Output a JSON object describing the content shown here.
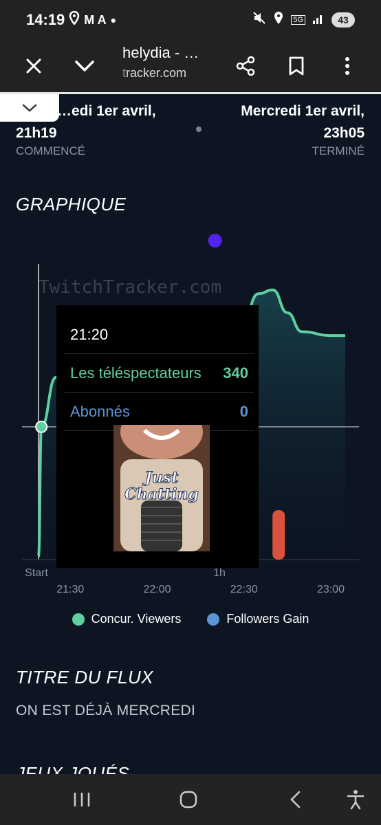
{
  "status": {
    "time": "14:19",
    "indicators": "M A",
    "battery": "43"
  },
  "browser": {
    "title": "helydia - …",
    "url_dim": "t",
    "url": "racker.com"
  },
  "stream": {
    "start_date": "…edi 1er avril,",
    "start_time": "21h19",
    "start_label": "COMMENCÉ",
    "end_date": "Mercredi 1er avril,",
    "end_time": "23h05",
    "end_label": "TERMINÉ"
  },
  "section_graph": "GRAPHIQUE",
  "section_title": "TITRE DU FLUX",
  "section_games": "JEUX JOUÉS",
  "stream_title": "ON EST DÉJÀ MERCREDI",
  "chart_data": {
    "type": "line",
    "watermark": "TwitchTracker.com",
    "x_ticks": [
      "21:30",
      "22:00",
      "22:30",
      "23:00"
    ],
    "x_time_labels": [
      "Start",
      "1h"
    ],
    "series": [
      {
        "name": "Concur. Viewers",
        "color": "#5fcf9f",
        "x": [
          "21:19",
          "21:20",
          "21:25",
          "21:30",
          "21:40",
          "21:50",
          "22:00",
          "22:10",
          "22:15",
          "22:25",
          "22:30",
          "22:35",
          "22:40",
          "22:45",
          "22:50",
          "23:00",
          "23:05"
        ],
        "values": [
          0,
          340,
          470,
          520,
          540,
          545,
          550,
          560,
          580,
          585,
          630,
          690,
          700,
          640,
          590,
          580,
          580
        ]
      },
      {
        "name": "Followers Gain",
        "color": "#5b95d8",
        "x": [
          "22:42"
        ],
        "values": [
          1
        ]
      }
    ],
    "highlight_bar": {
      "x": "22:42",
      "color": "#d9533c"
    },
    "marker_point": {
      "x": "22:20",
      "color": "#5222ee"
    }
  },
  "tooltip": {
    "time": "21:20",
    "viewers_label": "Les téléspectateurs",
    "viewers_value": "340",
    "followers_label": "Abonnés",
    "followers_value": "0",
    "image_text_1": "Just",
    "image_text_2": "Chatting"
  },
  "legend": {
    "viewers": "Concur. Viewers",
    "followers": "Followers Gain"
  },
  "colors": {
    "viewers": "#5fcf9f",
    "followers": "#5b95d8",
    "background": "#0d1523"
  }
}
